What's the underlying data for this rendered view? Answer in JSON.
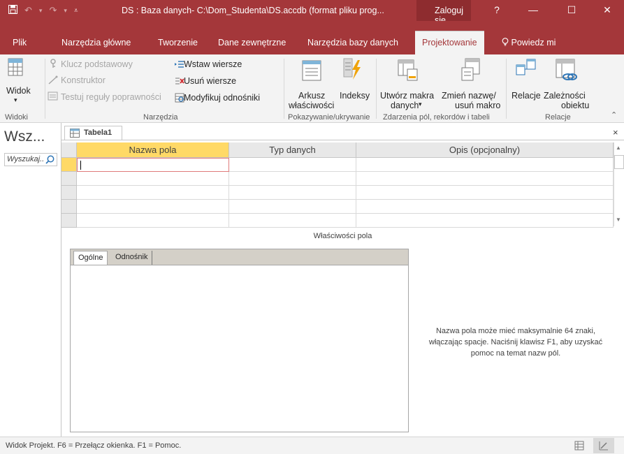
{
  "titlebar": {
    "title": "DS : Baza danych- C:\\Dom_Studenta\\DS.accdb (format pliku prog...",
    "login": "Zaloguj się",
    "help": "?",
    "minimize": "—",
    "maximize": "☐",
    "close": "✕"
  },
  "tabs": {
    "file": "Plik",
    "home": "Narzędzia główne",
    "create": "Tworzenie",
    "external": "Dane zewnętrzne",
    "dbtools": "Narzędzia bazy danych",
    "design": "Projektowanie",
    "tellme": "Powiedz mi"
  },
  "ribbon": {
    "view": "Widok",
    "view_group": "Widoki",
    "primary_key": "Klucz podstawowy",
    "builder": "Konstruktor",
    "test_rules": "Testuj reguły poprawności",
    "insert_rows": "Wstaw wiersze",
    "delete_rows": "Usuń wiersze",
    "modify_lookups": "Modyfikuj odnośniki",
    "tools_group": "Narzędzia",
    "property_sheet_1": "Arkusz",
    "property_sheet_2": "właściwości",
    "indexes": "Indeksy",
    "show_hide_group": "Pokazywanie/ukrywanie",
    "create_macros_1": "Utwórz makra",
    "create_macros_2": "danych",
    "rename_macro_1": "Zmień nazwę/",
    "rename_macro_2": "usuń makro",
    "events_group": "Zdarzenia pól, rekordów i tabeli",
    "relationships": "Relacje",
    "dependencies_1": "Zależności",
    "dependencies_2": "obiektu",
    "relations_group": "Relacje"
  },
  "navpane": {
    "title": "Wsz...",
    "search_placeholder": "Wyszukaj..."
  },
  "document": {
    "tab_label": "Tabela1",
    "close": "×",
    "columns": [
      "Nazwa pola",
      "Typ danych",
      "Opis (opcjonalny)"
    ],
    "field_properties_label": "Właściwości pola",
    "prop_tabs": [
      "Ogólne",
      "Odnośnik"
    ],
    "help_text": "Nazwa pola może mieć maksymalnie 64 znaki, włączając spacje. Naciśnij klawisz F1, aby uzyskać pomoc na temat nazw pól."
  },
  "statusbar": {
    "text": "Widok Projekt. F6 = Przełącz okienka. F1 = Pomoc."
  },
  "colors": {
    "accent": "#a4373a",
    "selected_header": "#ffd966"
  }
}
